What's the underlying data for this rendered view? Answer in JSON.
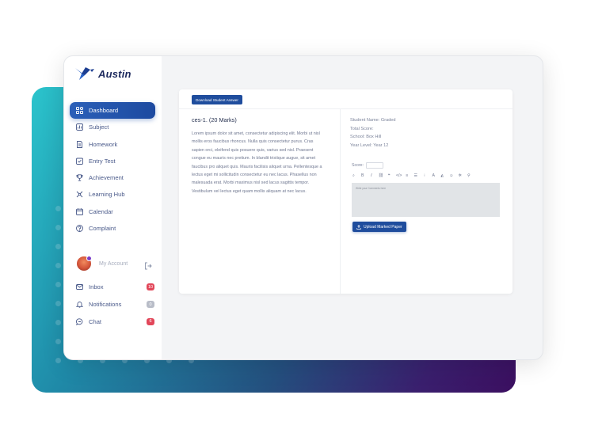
{
  "brand": {
    "name": "Austin",
    "logo_icon": "bird-logo-icon",
    "accent": "#1f4d9d"
  },
  "sidebar": {
    "items": [
      {
        "label": "Dashboard",
        "icon": "grid-icon",
        "active": true
      },
      {
        "label": "Subject",
        "icon": "chart-icon",
        "active": false
      },
      {
        "label": "Homework",
        "icon": "document-icon",
        "active": false
      },
      {
        "label": "Entry Test",
        "icon": "test-icon",
        "active": false
      },
      {
        "label": "Achievement",
        "icon": "trophy-icon",
        "active": false
      },
      {
        "label": "Learning Hub",
        "icon": "hub-icon",
        "active": false
      },
      {
        "label": "Calendar",
        "icon": "calendar-icon",
        "active": false
      },
      {
        "label": "Complaint",
        "icon": "question-icon",
        "active": false
      }
    ],
    "account_label": "My Account",
    "bottom_items": [
      {
        "label": "Inbox",
        "icon": "mail-icon",
        "badge": "10",
        "badge_color": "#e2475a"
      },
      {
        "label": "Notifications",
        "icon": "bell-icon",
        "badge": "0",
        "badge_color": "#b9bdc8"
      },
      {
        "label": "Chat",
        "icon": "chat-icon",
        "badge": "6",
        "badge_color": "#e2475a"
      }
    ]
  },
  "panel": {
    "download_label": "Download Student Answer",
    "question_title": "ces-1. (20 Marks)",
    "question_body": "Lorem ipsum dolor sit amet, consectetur adipiscing elit. Morbi ut nisl mollis eros faucibus rhoncus. Nulla quis consectetur purus. Cras sapien orci, eleifend quis posuere quis, varius sed nisl. Praesent congue eu mauris nec pretium. In blandit tristique augue, sit amet faucibus pro aliquet quis. Mauris facilisis aliquet urna. Pellentesque a lectus eget mi sollicitudin consectetur eu nec lacus. Phasellus non malesuada erat. Morbi maximus nisl sed lacus sagittis tempor. Vestibulum vel lectus eget quam mollis aliquam at nec lacus.",
    "student_name": "Student Name: Graded",
    "total_score": "Total Score:",
    "school": "School: Box Hill",
    "year_level": "Year Level: Year 12",
    "score_label": "Score:",
    "toolbar": [
      "⌕",
      "B",
      "I",
      "⛓",
      "❝",
      "</>",
      "≡",
      "☰",
      "⁝",
      "A",
      "◭",
      "☺",
      "✲",
      "⚲"
    ],
    "editor_placeholder": "Write your Comments here",
    "upload_label": "Upload Marked Paper"
  }
}
